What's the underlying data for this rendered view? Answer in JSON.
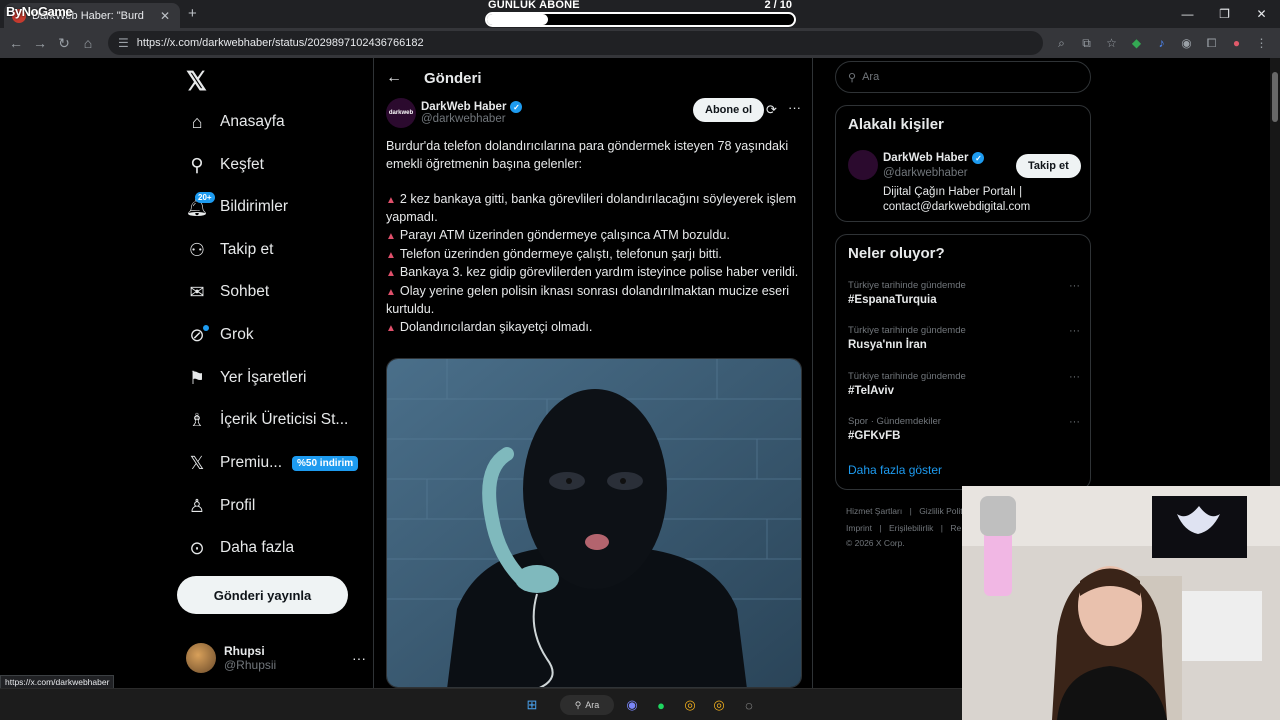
{
  "browser": {
    "tab_title": "DarkWeb Haber: \"Burd",
    "close_glyph": "✕",
    "new_tab_glyph": "+",
    "url": "https://x.com/darkwebhaber/status/2029897102436766182",
    "status_url": "https://x.com/darkwebhaber"
  },
  "overlay": {
    "logo_text": "ByNoGame",
    "subscription_label": "GÜNLÜK ABONE",
    "subscription_count": "2 / 10",
    "subscription_progress": 0.2
  },
  "nav": {
    "items": [
      {
        "label": "Anasayfa",
        "icon": "home-icon"
      },
      {
        "label": "Keşfet",
        "icon": "search-icon"
      },
      {
        "label": "Bildirimler",
        "icon": "bell-icon",
        "badge": "20+"
      },
      {
        "label": "Takip et",
        "icon": "follow-icon"
      },
      {
        "label": "Sohbet",
        "icon": "mail-icon"
      },
      {
        "label": "Grok",
        "icon": "grok-icon"
      },
      {
        "label": "Yer İşaretleri",
        "icon": "bookmark-icon"
      },
      {
        "label": "İçerik Üreticisi St...",
        "icon": "creator-icon"
      },
      {
        "label": "Premiu...",
        "icon": "x-icon",
        "badge": "%50 indirim"
      },
      {
        "label": "Profil",
        "icon": "person-icon"
      },
      {
        "label": "Daha fazla",
        "icon": "more-icon"
      }
    ],
    "post_button": "Gönderi yayınla",
    "profile": {
      "name": "Rhupsi",
      "handle": "@Rhupsii"
    }
  },
  "post": {
    "page_title": "Gönderi",
    "author_name": "DarkWeb Haber",
    "author_handle": "@darkwebhaber",
    "avatar_text": "darkweb",
    "subscribe_button": "Abone ol",
    "intro": "Burdur'da telefon dolandırıcılarına para göndermek isteyen 78 yaşındaki emekli öğretmenin başına gelenler:",
    "bullets": [
      "2 kez bankaya gitti, banka görevlileri dolandırılacağını söyleyerek işlem yapmadı.",
      "Parayı ATM üzerinden göndermeye çalışınca ATM bozuldu.",
      "Telefon üzerinden göndermeye çalıştı, telefonun şarjı bitti.",
      "Bankaya 3. kez gidip görevlilerden yardım isteyince polise haber verildi.",
      "Olay yerine gelen polisin iknası sonrası dolandırılmaktan mucize eseri kurtuldu.",
      "Dolandırıcılardan şikayetçi olmadı."
    ]
  },
  "right": {
    "search_placeholder": "Ara",
    "related": {
      "title": "Alakalı kişiler",
      "name": "DarkWeb Haber",
      "handle": "@darkwebhaber",
      "bio": "Dijital Çağın Haber Portalı | contact@darkwebdigital.com",
      "follow_button": "Takip et"
    },
    "trends": {
      "title": "Neler oluyor?",
      "items": [
        {
          "meta": "Türkiye tarihinde gündemde",
          "tag": "#EspanaTurquia"
        },
        {
          "meta": "Türkiye tarihinde gündemde",
          "tag": "Rusya'nın İran"
        },
        {
          "meta": "Türkiye tarihinde gündemde",
          "tag": "#TelAviv"
        },
        {
          "meta": "Spor · Gündemdekiler",
          "tag": "#GFKvFB"
        }
      ],
      "show_more": "Daha fazla göster"
    },
    "footer": {
      "line1": [
        "Hizmet Şartları",
        "|",
        "Gizlilik Politi"
      ],
      "line2": [
        "Imprint",
        "|",
        "Erişilebilirlik",
        "|",
        "Re"
      ],
      "copyright": "© 2026 X Corp."
    }
  },
  "taskbar": {
    "search_label": "Ara"
  },
  "colors": {
    "accent": "#1d9bf0",
    "background": "#000000",
    "border": "#2f3336",
    "bullet": "#e0506b"
  }
}
